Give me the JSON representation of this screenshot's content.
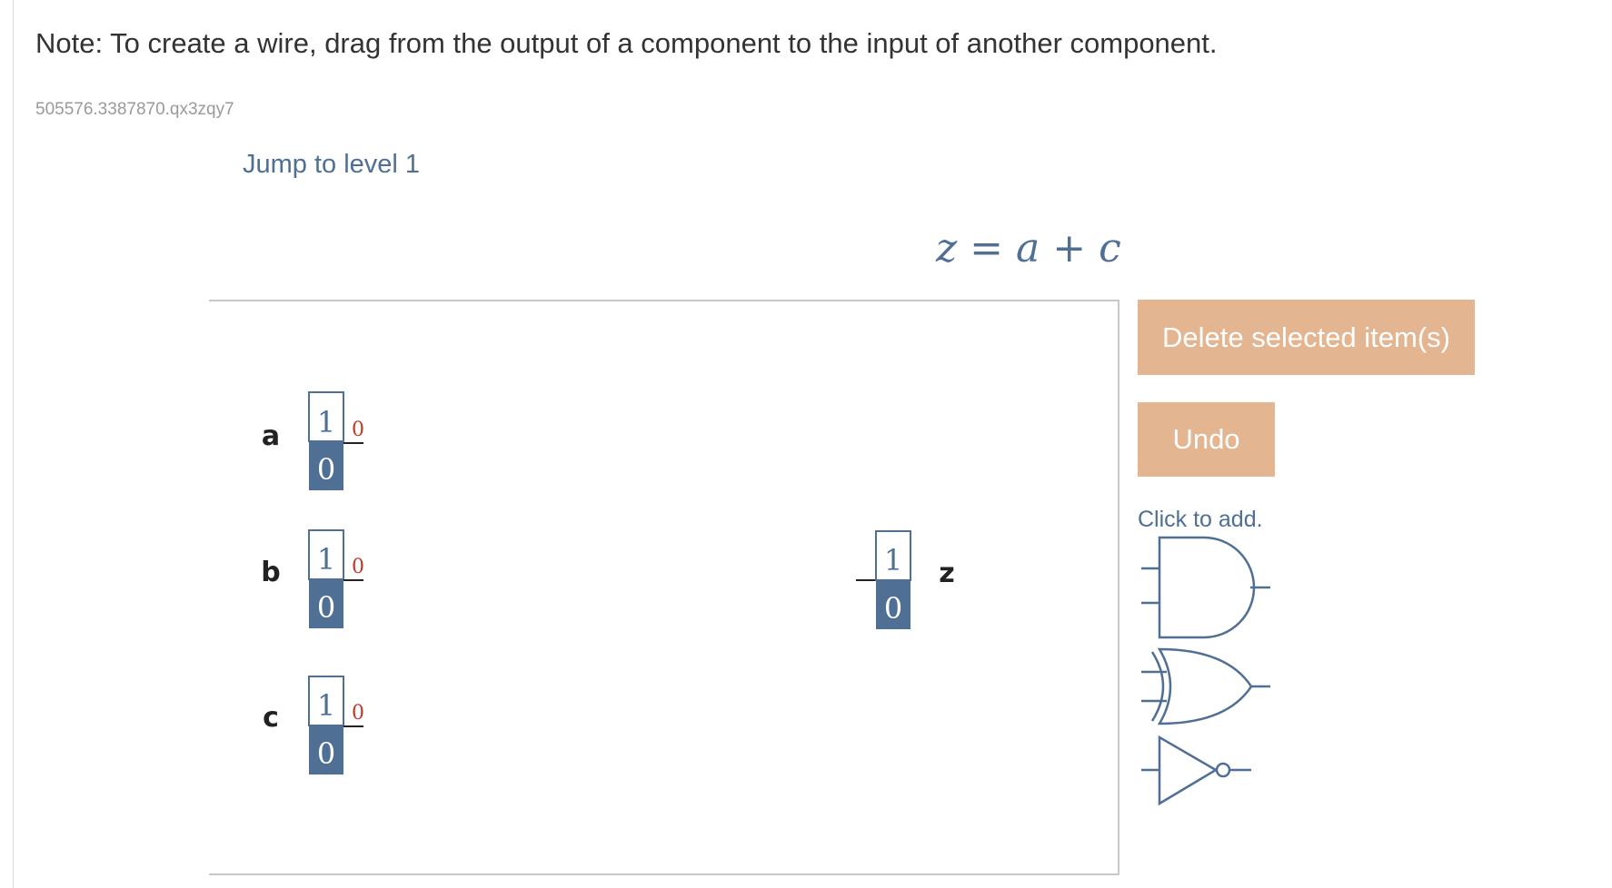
{
  "note": "Note: To create a wire, drag from the output of a component to the input of another component.",
  "activity_id": "505576.3387870.qx3zqy7",
  "jump_link": "Jump to level 1",
  "equation": "z = a + c",
  "buttons": {
    "delete": "Delete selected item(s)",
    "undo": "Undo"
  },
  "palette": {
    "label": "Click to add.",
    "gates": [
      "and-gate-icon",
      "or-gate-icon",
      "not-gate-icon"
    ]
  },
  "inputs": [
    {
      "name": "a",
      "toggle_top": "1",
      "toggle_bottom": "0",
      "value": "0"
    },
    {
      "name": "b",
      "toggle_top": "1",
      "toggle_bottom": "0",
      "value": "0"
    },
    {
      "name": "c",
      "toggle_top": "1",
      "toggle_bottom": "0",
      "value": "0"
    }
  ],
  "output": {
    "name": "z",
    "top": "1",
    "bottom": "0"
  },
  "colors": {
    "accent_blue": "#4f6f94",
    "button_orange": "#e3b591",
    "value_red": "#c0392b"
  }
}
